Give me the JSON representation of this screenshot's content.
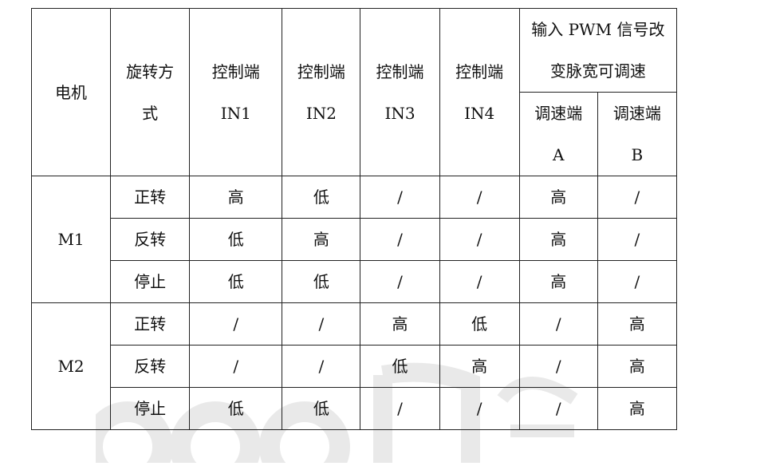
{
  "header": {
    "motor": "电机",
    "rotation_line1": "旋转方",
    "rotation_line2": "式",
    "in1_line1": "控制端",
    "in1_line2": "IN1",
    "in2_line1": "控制端",
    "in2_line2": "IN2",
    "in3_line1": "控制端",
    "in3_line2": "IN3",
    "in4_line1": "控制端",
    "in4_line2": "IN4",
    "pwm_line1": "输入 PWM 信号改",
    "pwm_line2": "变脉宽可调速",
    "ena_line1": "调速端",
    "ena_line2": "A",
    "enb_line1": "调速端",
    "enb_line2": "B"
  },
  "rows": [
    {
      "motor": "M1",
      "mode": "正转",
      "in1": "高",
      "in2": "低",
      "in3": "/",
      "in4": "/",
      "ena": "高",
      "enb": "/"
    },
    {
      "mode": "反转",
      "in1": "低",
      "in2": "高",
      "in3": "/",
      "in4": "/",
      "ena": "高",
      "enb": "/"
    },
    {
      "mode": "停止",
      "in1": "低",
      "in2": "低",
      "in3": "/",
      "in4": "/",
      "ena": "高",
      "enb": "/"
    },
    {
      "motor": "M2",
      "mode": "正转",
      "in1": "/",
      "in2": "/",
      "in3": "高",
      "in4": "低",
      "ena": "/",
      "enb": "高"
    },
    {
      "mode": "反转",
      "in1": "/",
      "in2": "/",
      "in3": "低",
      "in4": "高",
      "ena": "/",
      "enb": "高"
    },
    {
      "mode": "停止",
      "in1": "低",
      "in2": "低",
      "in3": "/",
      "in4": "/",
      "ena": "/",
      "enb": "高"
    }
  ]
}
